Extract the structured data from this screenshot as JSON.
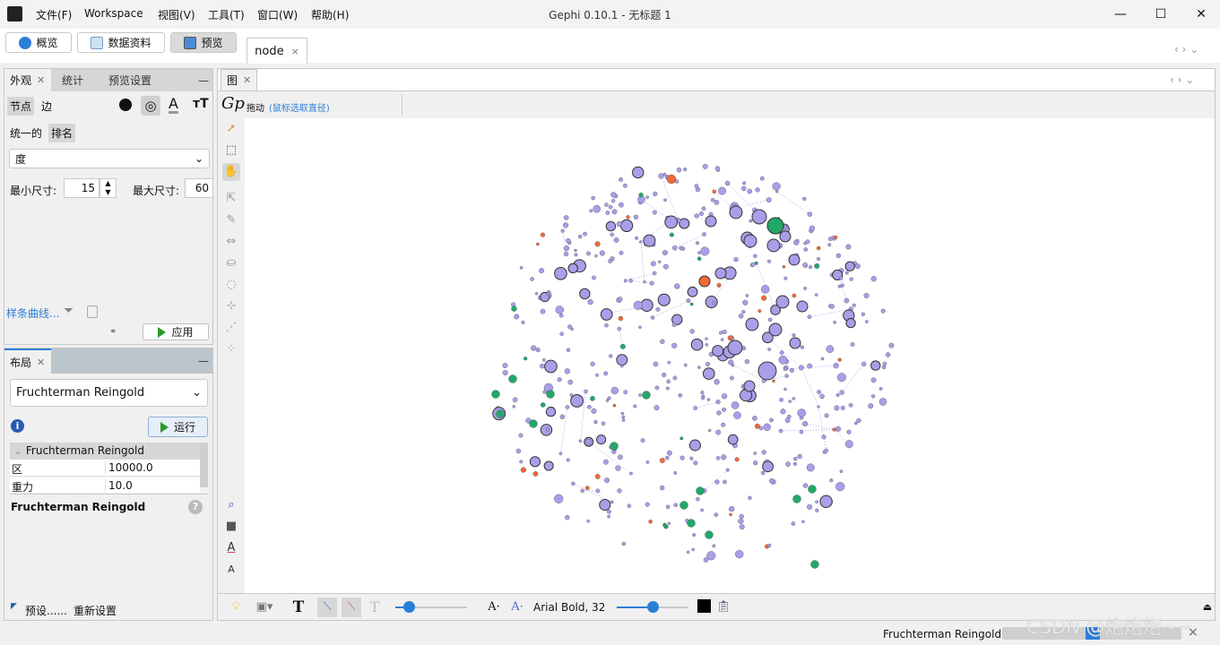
{
  "window": {
    "title": "Gephi 0.10.1 - 无标题 1",
    "minimize": "—",
    "maximize": "☐",
    "close": "✕"
  },
  "menu": [
    "文件(F)",
    "Workspace",
    "视图(V)",
    "工具(T)",
    "窗口(W)",
    "帮助(H)"
  ],
  "toolbar": {
    "overview": "概览",
    "data_lab": "数据资料",
    "preview": "预览"
  },
  "doc_tab": {
    "label": "node",
    "close": "×"
  },
  "appearance": {
    "tabs": [
      "外观",
      "统计",
      "预览设置"
    ],
    "element_tabs": [
      "节点",
      "边"
    ],
    "mode_tabs": [
      "统一的",
      "排名"
    ],
    "attribute": "度",
    "min_size_label": "最小尺寸:",
    "min_size": "15",
    "max_size_label": "最大尺寸:",
    "max_size": "60",
    "spline": "样条曲线...",
    "apply": "应用"
  },
  "layout": {
    "tab": "布局",
    "algorithm": "Fruchterman Reingold",
    "run": "运行",
    "section": "Fruchterman Reingold",
    "props": [
      {
        "name": "区",
        "value": "10000.0"
      },
      {
        "name": "重力",
        "value": "10.0"
      }
    ],
    "desc_title": "Fruchterman Reingold",
    "presets": "预设......",
    "reset": "重新设置"
  },
  "graph": {
    "tab": "图",
    "mode": "拖动",
    "hint": "(鼠标选取直径)",
    "font_label": "Arial Bold, 32",
    "colors": {
      "purple": "#a99ee8",
      "orange": "#f06a3a",
      "green": "#22a86a",
      "edge": "#6a5ad8"
    }
  },
  "status": {
    "task": "Fruchterman Reingold",
    "progress_percent": 25,
    "close": "×"
  },
  "watermark": "CSDN @炮炮炮~~"
}
